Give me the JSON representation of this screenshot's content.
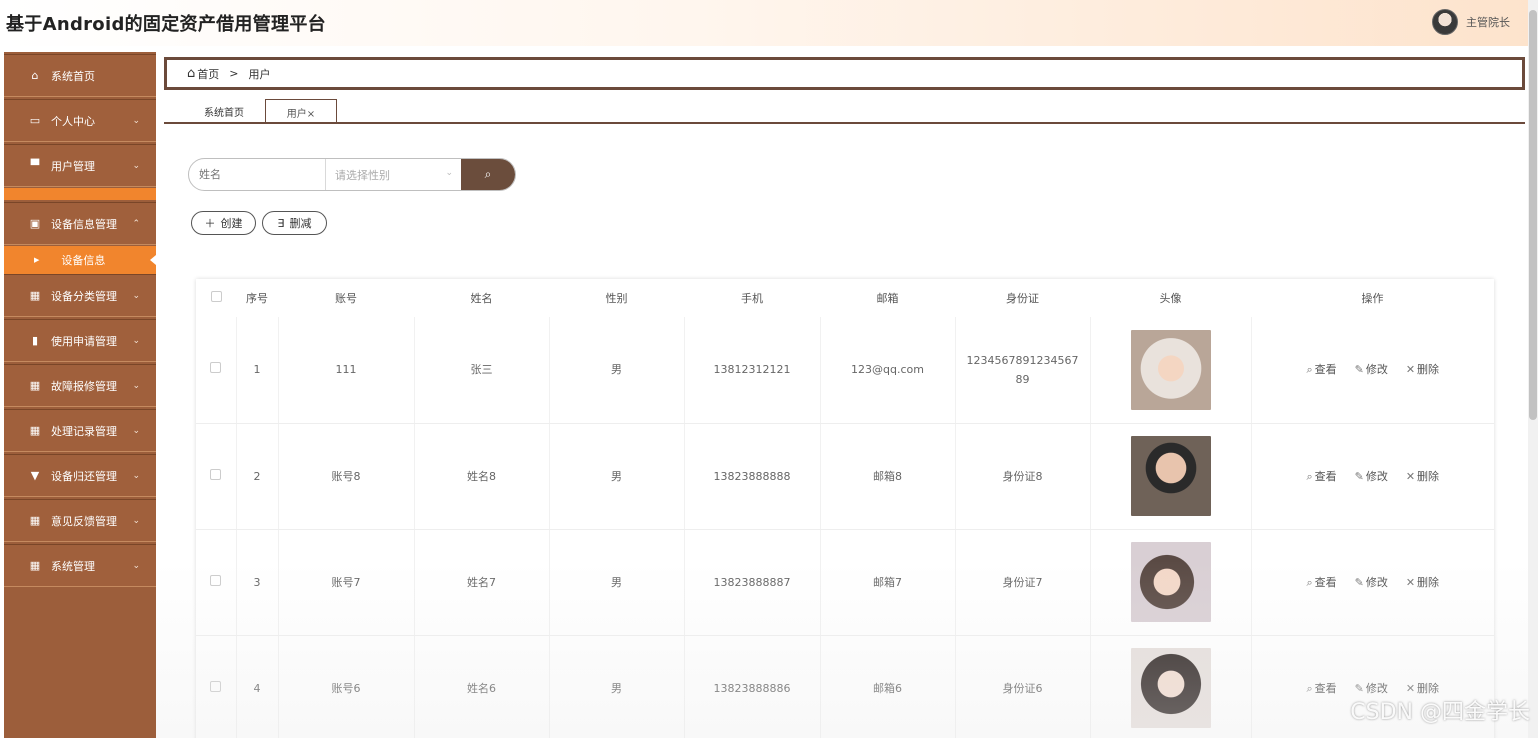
{
  "app": {
    "title": "基于Android的固定资产借用管理平台",
    "user_name": "主管院长"
  },
  "sidebar": {
    "items": [
      {
        "label": "系统首页",
        "icon": "home-icon",
        "glyph": "⌂",
        "arrow": ""
      },
      {
        "label": "个人中心",
        "icon": "card-icon",
        "glyph": "▭",
        "arrow": "⌄"
      },
      {
        "label": "用户管理",
        "icon": "monitor-icon",
        "glyph": "▀",
        "arrow": "⌄"
      },
      {
        "label": "设备信息管理",
        "icon": "clipboard-icon",
        "glyph": "▣",
        "arrow": "⌃"
      },
      {
        "label": "设备分类管理",
        "icon": "grid-icon",
        "glyph": "▦",
        "arrow": "⌄"
      },
      {
        "label": "使用申请管理",
        "icon": "bar-chart-icon",
        "glyph": "▮",
        "arrow": "⌄"
      },
      {
        "label": "故障报修管理",
        "icon": "grid-icon",
        "glyph": "▦",
        "arrow": "⌄"
      },
      {
        "label": "处理记录管理",
        "icon": "grid-icon",
        "glyph": "▦",
        "arrow": "⌄"
      },
      {
        "label": "设备归还管理",
        "icon": "cup-icon",
        "glyph": "▼",
        "arrow": "⌄"
      },
      {
        "label": "意见反馈管理",
        "icon": "grid-icon",
        "glyph": "▦",
        "arrow": "⌄"
      },
      {
        "label": "系统管理",
        "icon": "grid-icon",
        "glyph": "▦",
        "arrow": "⌄"
      }
    ],
    "sub_item": "设备信息"
  },
  "breadcrumb": {
    "home": "首页",
    "separator": ">",
    "current": "用户"
  },
  "tabs": {
    "home": "系统首页",
    "user": "用户×"
  },
  "search": {
    "name_placeholder": "姓名",
    "gender_placeholder": "请选择性别"
  },
  "actions": {
    "create": "创建",
    "delete": "删减"
  },
  "table": {
    "headers": [
      "序号",
      "账号",
      "姓名",
      "性别",
      "手机",
      "邮箱",
      "身份证",
      "头像",
      "操作"
    ],
    "ops": {
      "view": "查看",
      "edit": "修改",
      "delete": "删除"
    },
    "rows": [
      {
        "no": "1",
        "account": "111",
        "name": "张三",
        "gender": "男",
        "phone": "13812312121",
        "email": "123@qq.com",
        "id_card": "123456789123456789",
        "avatar": "avatar-photo-1"
      },
      {
        "no": "2",
        "account": "账号8",
        "name": "姓名8",
        "gender": "男",
        "phone": "13823888888",
        "email": "邮箱8",
        "id_card": "身份证8",
        "avatar": "avatar-photo-2"
      },
      {
        "no": "3",
        "account": "账号7",
        "name": "姓名7",
        "gender": "男",
        "phone": "13823888887",
        "email": "邮箱7",
        "id_card": "身份证7",
        "avatar": "avatar-photo-3"
      },
      {
        "no": "4",
        "account": "账号6",
        "name": "姓名6",
        "gender": "男",
        "phone": "13823888886",
        "email": "邮箱6",
        "id_card": "身份证6",
        "avatar": "avatar-photo-4"
      }
    ]
  },
  "watermark": "CSDN @四金学长",
  "colors": {
    "sidebar": "#a0603c",
    "accent": "#f1852d",
    "dark_brown": "#6b4d3c"
  }
}
